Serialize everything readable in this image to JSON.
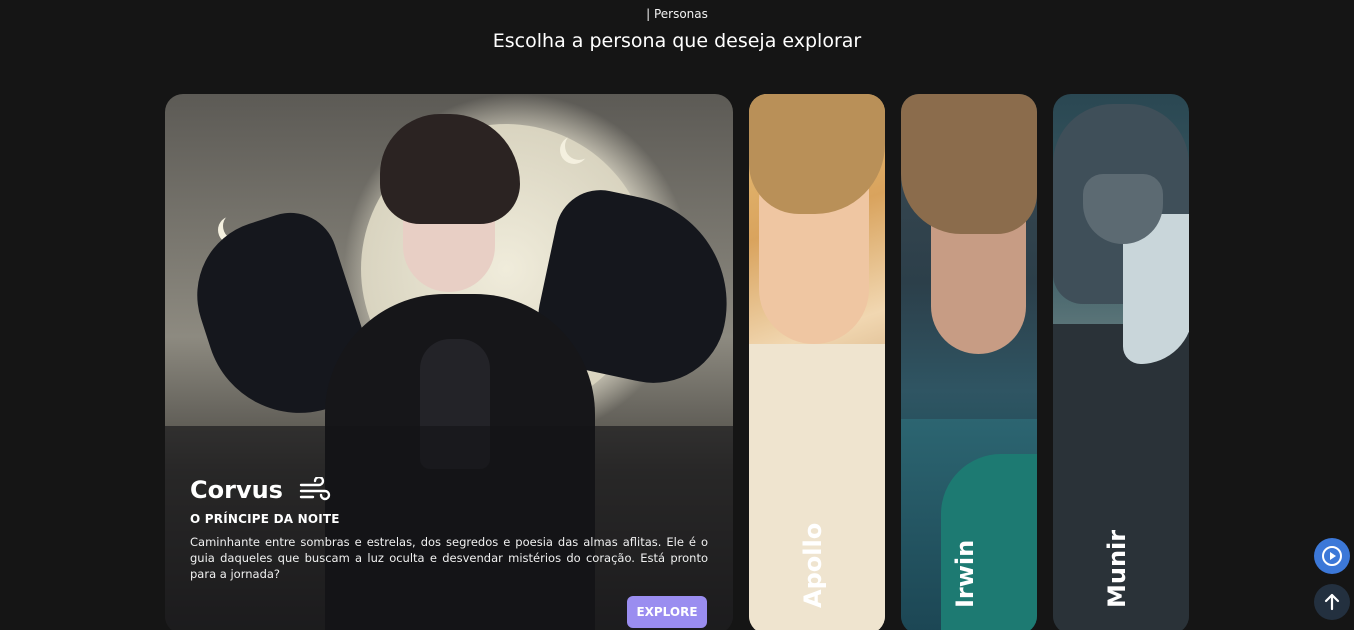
{
  "header": {
    "eyebrow": "| Personas",
    "title": "Escolha a persona que deseja explorar"
  },
  "featured": {
    "name": "Corvus",
    "icon": "wind-icon",
    "subtitle": "O PRÍNCIPE DA NOITE",
    "description": "Caminhante entre sombras e estrelas, dos segredos e poesia das almas aflitas. Ele é o guia daqueles que buscam a luz oculta e desvendar mistérios do coração. Está pronto para a jornada?",
    "button_label": "EXPLORE",
    "button_color": "#9a8df0"
  },
  "personas": [
    {
      "name": "Apollo"
    },
    {
      "name": "Irwin"
    },
    {
      "name": "Munir"
    }
  ],
  "floating_buttons": {
    "play": {
      "icon": "play-circle-icon",
      "color": "#3c78d8"
    },
    "top": {
      "icon": "arrow-up-icon",
      "color": "#23303f"
    }
  },
  "colors": {
    "background": "#151515",
    "accent": "#9a8df0"
  }
}
